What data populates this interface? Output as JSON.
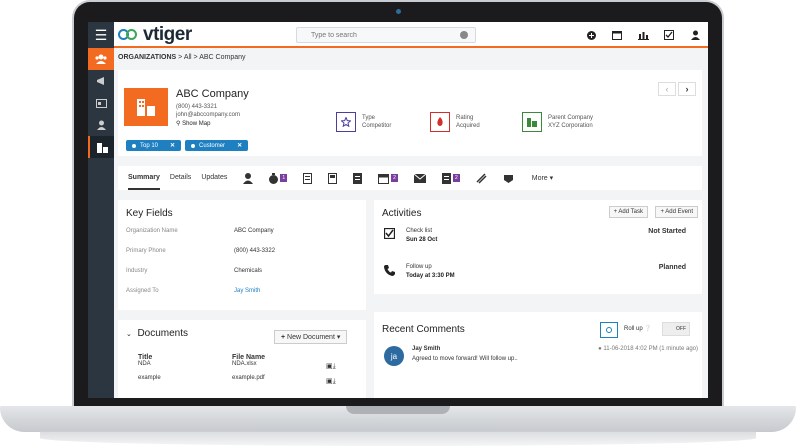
{
  "app": {
    "logo_text": "vtiger",
    "search_placeholder": "Type to search"
  },
  "breadcrumb": {
    "module": "ORGANIZATIONS",
    "sep1": ">",
    "all": "All",
    "sep2": ">",
    "record": "ABC Company"
  },
  "header": {
    "name": "ABC Company",
    "phone": "(800) 443-3321",
    "email": "john@abccompany.com",
    "map": "Show Map",
    "tags": [
      "Top 10",
      "Customer"
    ],
    "facts": [
      {
        "label": "Type",
        "value": "Competitor",
        "color": "#4a3f9e",
        "icon": "star-icon"
      },
      {
        "label": "Rating",
        "value": "Acquired",
        "color": "#d42d2d",
        "icon": "flame-icon"
      },
      {
        "label": "Parent Company",
        "value": "XYZ Corporation",
        "color": "#3a8a3a",
        "icon": "building-icon"
      }
    ]
  },
  "tabs": {
    "summary": "Summary",
    "details": "Details",
    "updates": "Updates",
    "badges": [
      "1",
      "2",
      "2"
    ],
    "more": "More"
  },
  "key_fields": {
    "title": "Key Fields",
    "rows": [
      {
        "label": "Organization Name",
        "value": "ABC Company"
      },
      {
        "label": "Primary Phone",
        "value": "(800) 443-3322"
      },
      {
        "label": "Industry",
        "value": "Chemicals"
      },
      {
        "label": "Assigned To",
        "value": "Jay Smith"
      }
    ]
  },
  "activities": {
    "title": "Activities",
    "add_task": "+ Add Task",
    "add_event": "+ Add Event",
    "items": [
      {
        "title": "Check list",
        "when": "Sun 28 Oct",
        "status": "Not Started",
        "icon": "checkbox-icon"
      },
      {
        "title": "Follow up",
        "when": "Today at 3:30 PM",
        "status": "Planned",
        "icon": "phone-icon"
      }
    ]
  },
  "documents": {
    "title": "Documents",
    "new_doc": "New Document",
    "col_title": "Title",
    "col_file": "File Name",
    "rows": [
      {
        "title": "NDA",
        "file": "NDA.xlsx"
      },
      {
        "title": "example",
        "file": "example.pdf"
      }
    ]
  },
  "comments": {
    "title": "Recent Comments",
    "rollup": "Roll up",
    "toggle": "OFF",
    "author": "Jay Smith",
    "initials": "ja",
    "text": "Agreed to move forward! Will follow up..",
    "time": "11-06-2018 4:02 PM (1 minute ago)"
  }
}
